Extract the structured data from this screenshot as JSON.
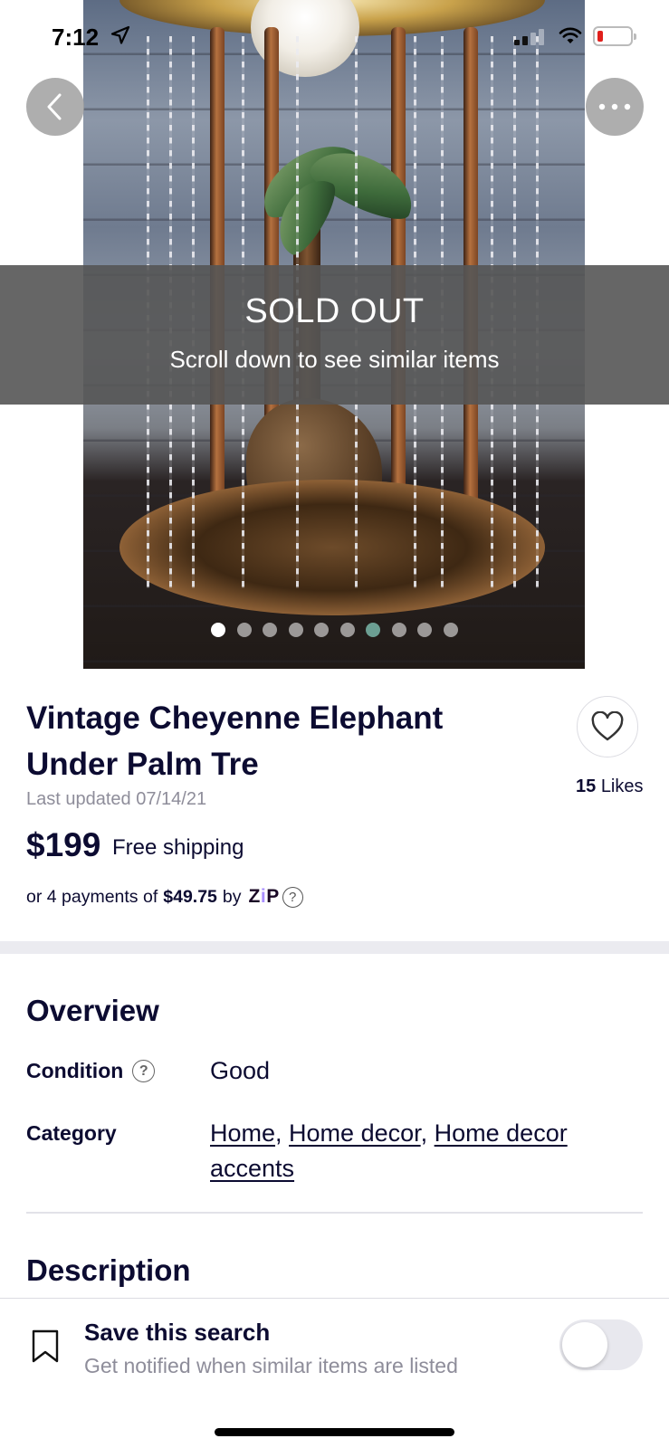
{
  "status_bar": {
    "time": "7:12"
  },
  "hero": {
    "sold_title": "SOLD OUT",
    "sold_subtitle": "Scroll down to see similar items",
    "photo_count": 10,
    "active_photo": 1
  },
  "product": {
    "title": "Vintage Cheyenne Elephant Under Palm Tre",
    "last_updated": "Last updated 07/14/21",
    "likes_count": "15",
    "likes_label": "Likes",
    "price": "$199",
    "shipping": "Free shipping",
    "pay_prefix": "or 4 payments of",
    "pay_amount": "$49.75",
    "pay_by": "by",
    "pay_provider": "zip"
  },
  "overview": {
    "title": "Overview",
    "condition_label": "Condition",
    "condition_value": "Good",
    "category_label": "Category",
    "categories": [
      "Home",
      "Home decor",
      "Home decor accents"
    ]
  },
  "description": {
    "title": "Description"
  },
  "save_search": {
    "title": "Save this search",
    "subtitle": "Get notified when similar items are listed",
    "enabled": false
  },
  "colors": {
    "text_primary": "#0c0b31",
    "text_secondary": "#8e8d9a",
    "zip_accent": "#aa8fff",
    "battery_low": "#e0201c"
  }
}
